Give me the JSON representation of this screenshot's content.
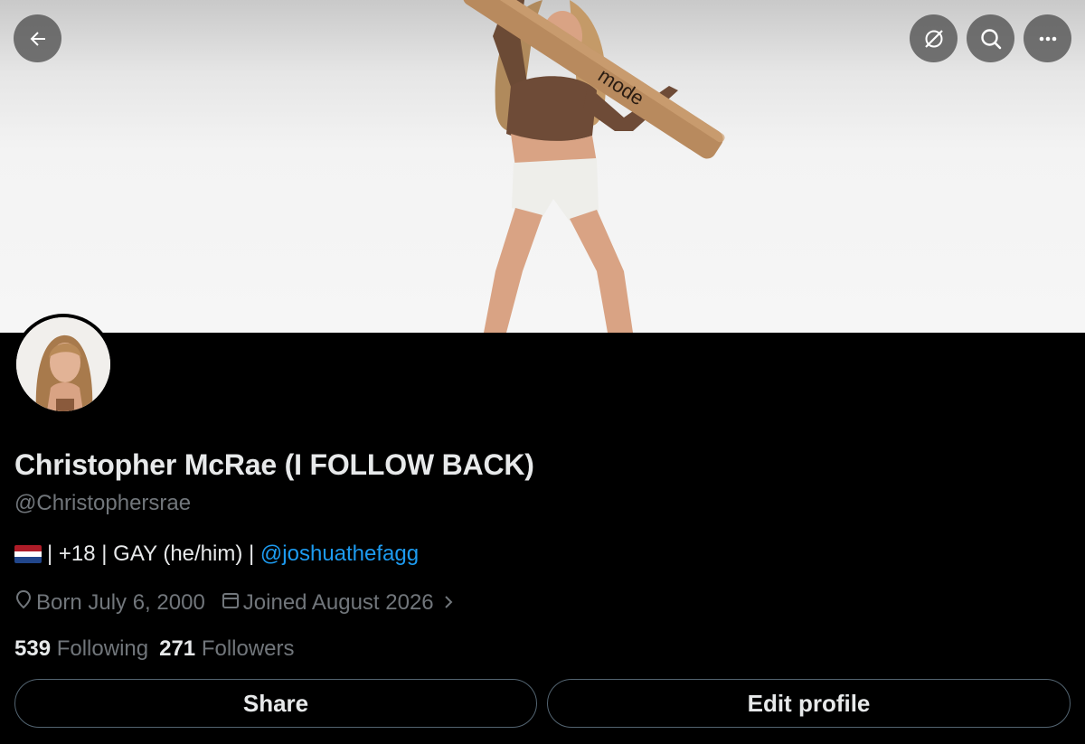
{
  "profile": {
    "display_name": "Christopher McRae (I FOLLOW BACK)",
    "handle": "@Christophersrae",
    "bio_text": "| +18 | GAY (he/him) |",
    "bio_mention": "@joshuathefagg",
    "bio_flag": "netherlands-flag",
    "born": "Born July 6, 2000",
    "joined": "Joined August 2026",
    "following_count": "539",
    "following_label": "Following",
    "followers_count": "271",
    "followers_label": "Followers"
  },
  "banner": {
    "tube_text": "mode"
  },
  "actions": {
    "share_label": "Share",
    "edit_label": "Edit profile"
  },
  "icons": {
    "back": "back-arrow-icon",
    "hide": "hide-icon",
    "search": "search-icon",
    "more": "more-icon",
    "location": "location-pin-icon",
    "calendar": "calendar-icon",
    "chevron": "chevron-right-icon"
  },
  "colors": {
    "background": "#000000",
    "primary_text": "#e7e9ea",
    "secondary_text": "#71767b",
    "link": "#1d9bf0",
    "border": "#536471"
  }
}
